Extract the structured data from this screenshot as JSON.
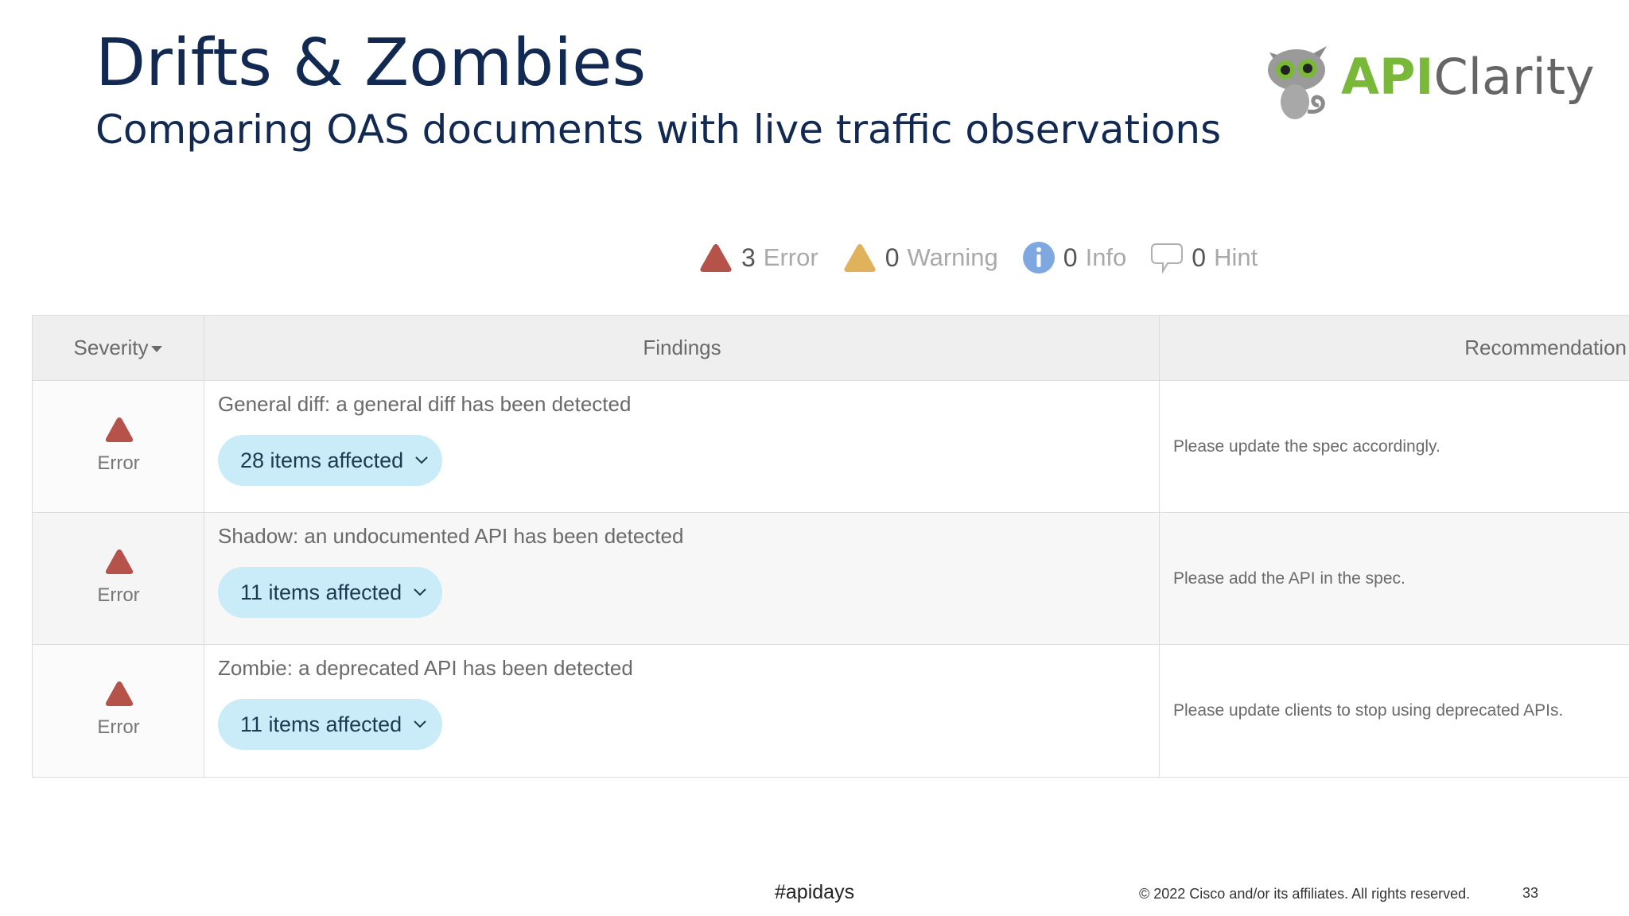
{
  "slide": {
    "title": "Drifts & Zombies",
    "subtitle": "Comparing OAS documents with live traffic observations"
  },
  "logo": {
    "api_text": "API",
    "clarity_text": "Clarity",
    "mascot_icon": "cat-mascot-icon",
    "api_color": "#7ab83a"
  },
  "summary": {
    "error": {
      "count": "3",
      "label": "Error",
      "icon": "error-triangle-icon",
      "color": "#b5524a"
    },
    "warning": {
      "count": "0",
      "label": "Warning",
      "icon": "warning-triangle-icon",
      "color": "#e0b25c"
    },
    "info": {
      "count": "0",
      "label": "Info",
      "icon": "info-circle-icon",
      "color": "#7fa8e0"
    },
    "hint": {
      "count": "0",
      "label": "Hint",
      "icon": "speech-bubble-icon"
    }
  },
  "table": {
    "headers": {
      "severity": "Severity",
      "findings": "Findings",
      "recommendation": "Recommendation"
    },
    "rows": [
      {
        "severity": "Error",
        "finding": "General diff: a general diff has been detected",
        "affected": "28 items affected",
        "recommendation": "Please update the spec accordingly."
      },
      {
        "severity": "Error",
        "finding": "Shadow: an undocumented API has been detected",
        "affected": "11 items affected",
        "recommendation": "Please add the API in the spec."
      },
      {
        "severity": "Error",
        "finding": "Zombie: a deprecated API has been detected",
        "affected": "11 items affected",
        "recommendation": "Please update clients to stop using deprecated APIs."
      }
    ]
  },
  "footer": {
    "hashtag": "#apidays",
    "copyright": "© 2022  Cisco and/or its affiliates. All rights reserved.",
    "page_number": "33"
  }
}
